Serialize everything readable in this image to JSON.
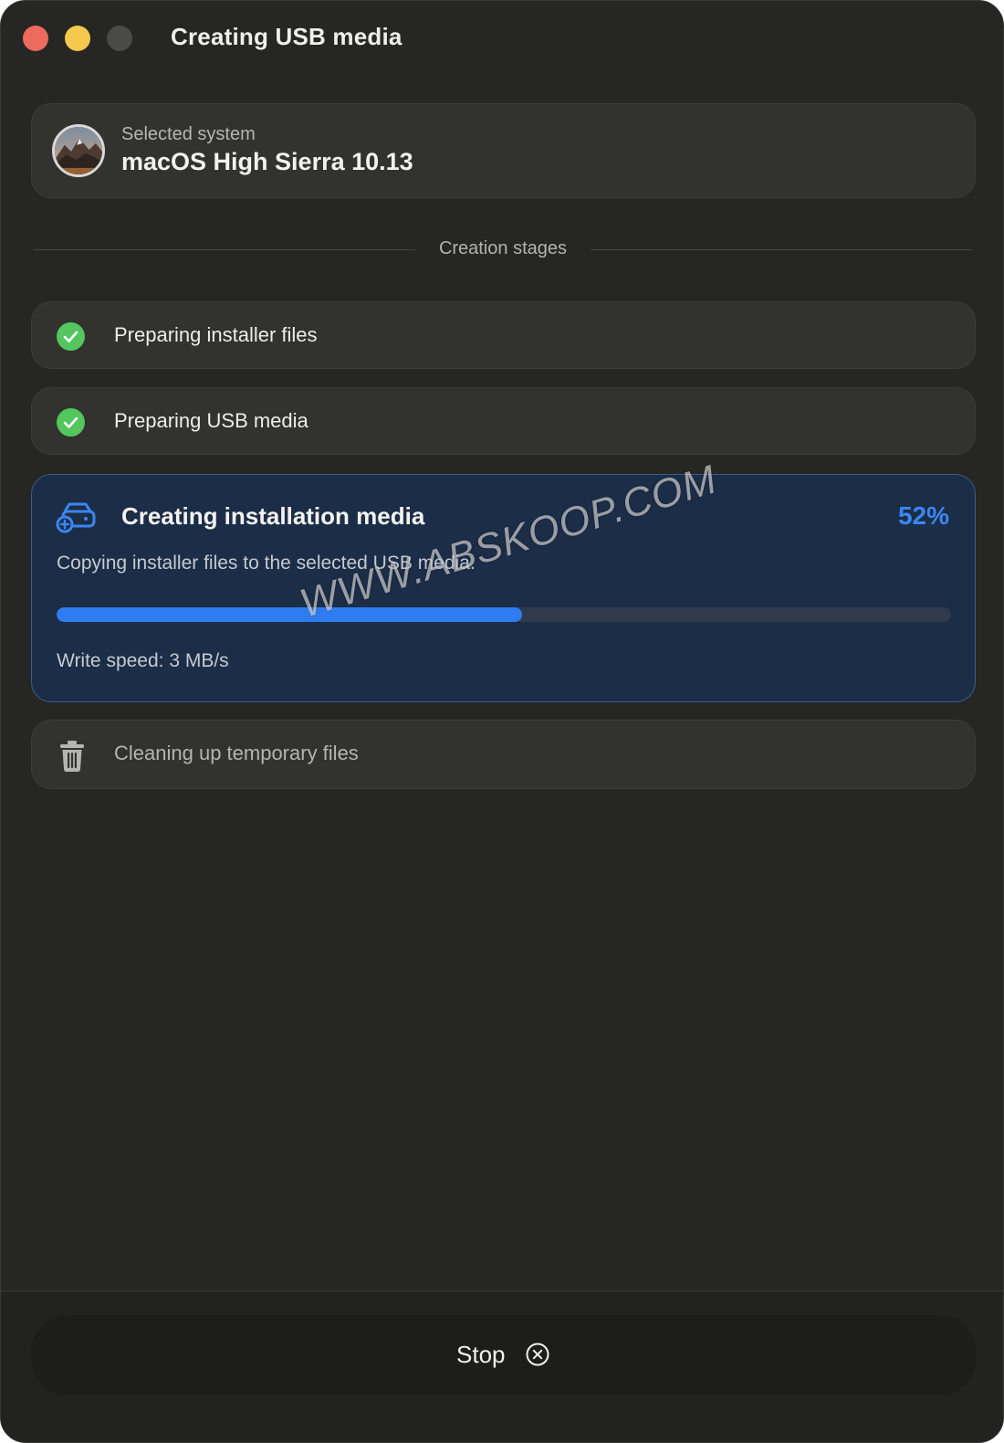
{
  "window": {
    "title": "Creating USB media",
    "traffic_colors": {
      "close": "#ed6a5e",
      "minimize": "#f5c94e",
      "zoom": "#4a4a48"
    }
  },
  "selected_system": {
    "label": "Selected system",
    "name": "macOS High Sierra 10.13",
    "icon": "macos-high-sierra-icon"
  },
  "section": {
    "title": "Creation stages"
  },
  "stages": [
    {
      "label": "Preparing installer files",
      "status": "done",
      "icon": "check-circle-icon"
    },
    {
      "label": "Preparing USB media",
      "status": "done",
      "icon": "check-circle-icon"
    },
    {
      "label": "Creating installation media",
      "status": "active",
      "icon": "drive-add-icon",
      "percent_text": "52%",
      "progress": 0.52,
      "description": "Copying installer files to the selected USB media.",
      "write_speed": "Write speed: 3 MB/s"
    },
    {
      "label": "Cleaning up temporary files",
      "status": "pending",
      "icon": "trash-icon"
    }
  ],
  "watermark": "WWW.ABSKOOP.COM",
  "actions": {
    "stop_label": "Stop",
    "stop_icon": "x-circle-icon"
  },
  "colors": {
    "accent": "#2f7cf0",
    "success": "#54c65d",
    "background": "#262624"
  }
}
